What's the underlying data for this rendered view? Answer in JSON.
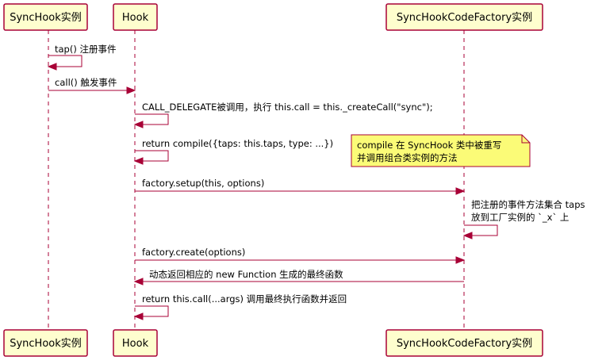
{
  "colors": {
    "participant_fill": "#FEFECE",
    "border": "#A80036",
    "note_fill": "#FBFB77"
  },
  "participants": [
    {
      "id": "sync-hook-instance",
      "label": "SyncHook实例"
    },
    {
      "id": "hook",
      "label": "Hook"
    },
    {
      "id": "factory-instance",
      "label": "SyncHookCodeFactory实例"
    }
  ],
  "messages": [
    {
      "from": "sync-hook-instance",
      "to": "sync-hook-instance",
      "lines": [
        "tap() 注册事件"
      ]
    },
    {
      "from": "sync-hook-instance",
      "to": "hook",
      "lines": [
        "call() 触发事件"
      ]
    },
    {
      "from": "hook",
      "to": "hook",
      "lines": [
        "CALL_DELEGATE被调用，执行 this.call = this._createCall(\"sync\");"
      ]
    },
    {
      "from": "hook",
      "to": "hook",
      "lines": [
        "return compile({taps: this.taps, type: ...})"
      ]
    },
    {
      "from": "hook",
      "to": "factory-instance",
      "lines": [
        "factory.setup(this, options)"
      ]
    },
    {
      "from": "factory-instance",
      "to": "factory-instance",
      "lines": [
        "把注册的事件方法集合 taps",
        "放到工厂实例的 `_x` 上"
      ]
    },
    {
      "from": "hook",
      "to": "factory-instance",
      "lines": [
        "factory.create(options)"
      ]
    },
    {
      "from": "factory-instance",
      "to": "hook",
      "lines": [
        "动态返回相应的 new Function 生成的最终函数"
      ]
    },
    {
      "from": "hook",
      "to": "hook",
      "lines": [
        "return this.call(...args) 调用最终执行函数并返回"
      ]
    }
  ],
  "notes": [
    {
      "lines": [
        "compile 在 SyncHook 类中被重写",
        "并调用组合类实例的方法"
      ]
    }
  ]
}
